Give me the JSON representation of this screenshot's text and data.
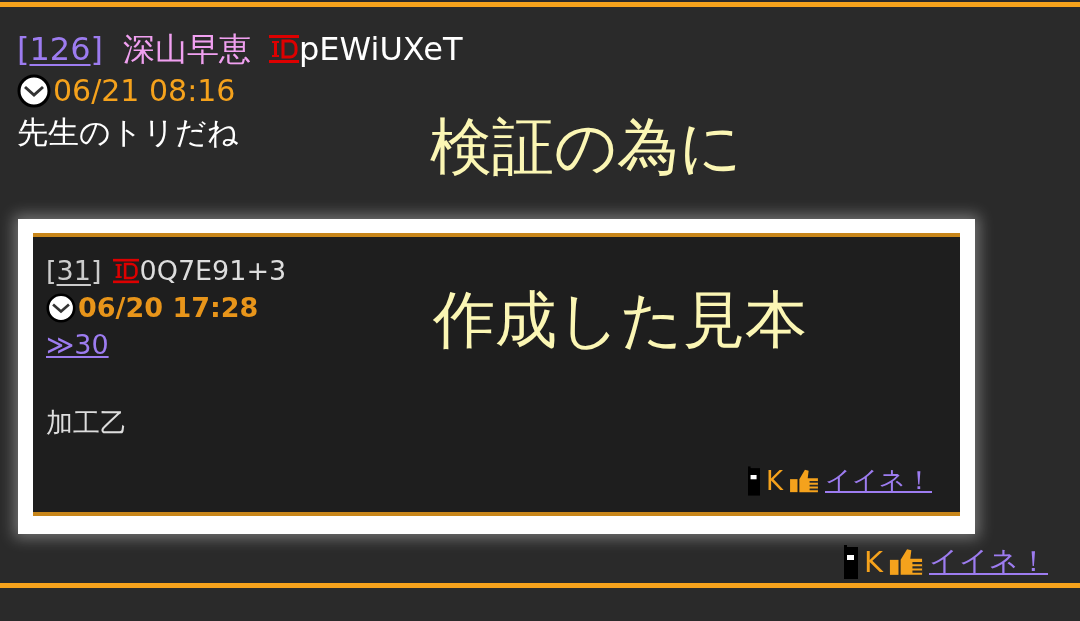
{
  "post": {
    "number_open": "[",
    "number": "126",
    "number_close": "]",
    "name": "深山早恵",
    "id": "pEWiUXeT",
    "date": "06/21 08:16",
    "body": "先生のトリだね",
    "quoted_image": {
      "number_open": "[",
      "number": "31",
      "number_close": "]",
      "id": "0Q7E91+3",
      "date": "06/20 17:28",
      "reply_link": "≫30",
      "body": "加工乙",
      "footer": {
        "k": "K",
        "like": "イイネ！"
      }
    },
    "footer": {
      "k": "K",
      "like": "イイネ！"
    }
  },
  "annotations": [
    {
      "text": "検証の為に"
    },
    {
      "text": "作成した見本"
    }
  ]
}
